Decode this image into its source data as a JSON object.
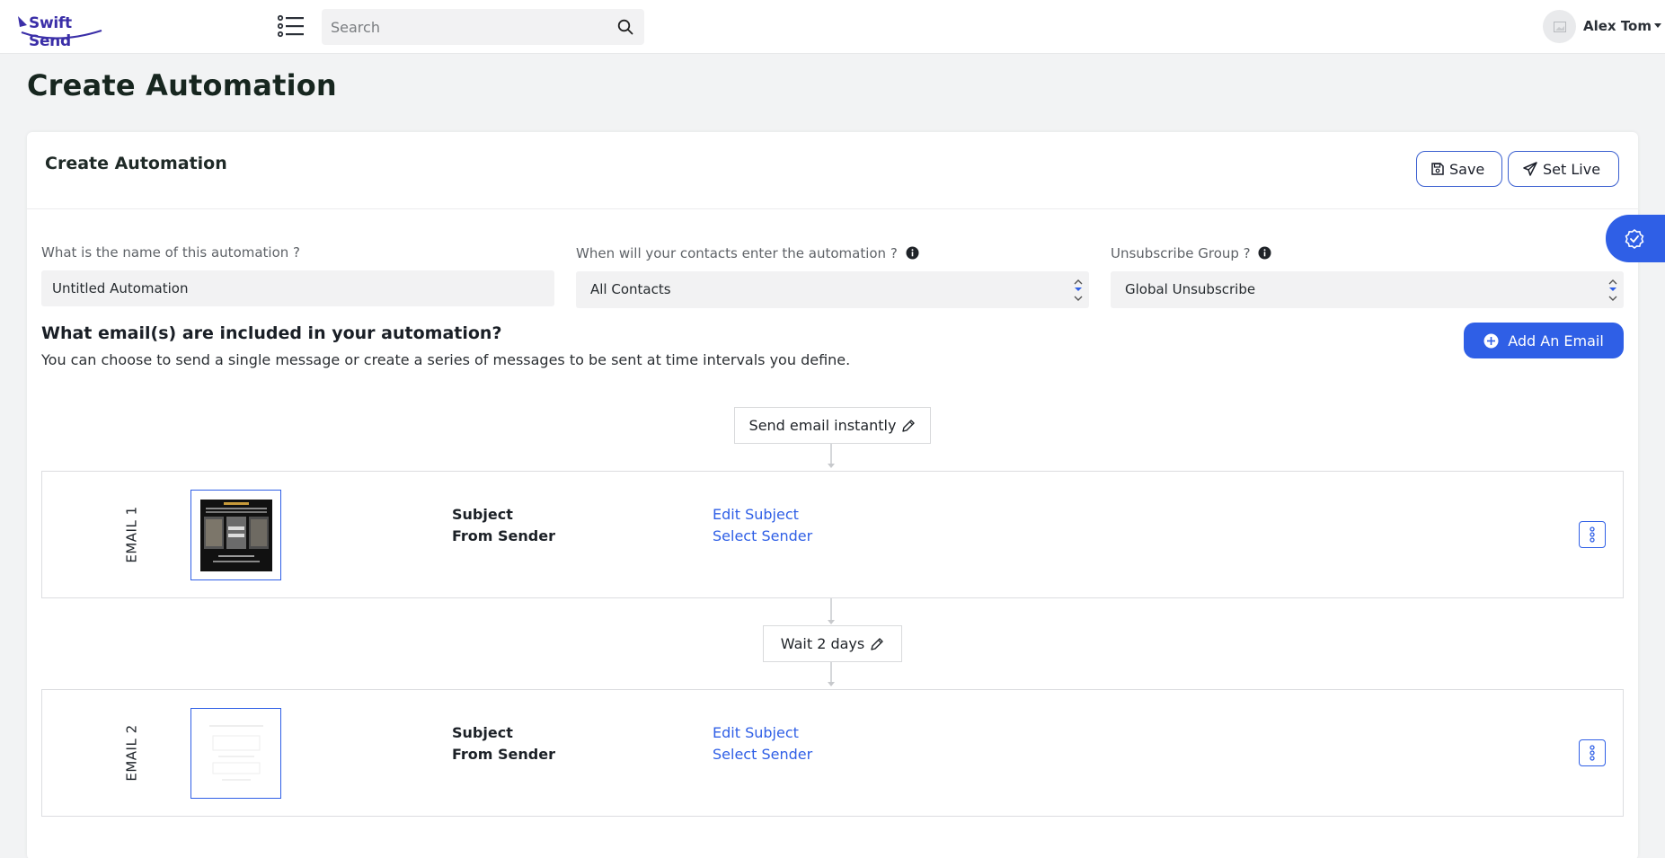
{
  "header": {
    "logo_text": "Swift Send",
    "search_placeholder": "Search",
    "user_name": "Alex Tom"
  },
  "page": {
    "title": "Create Automation"
  },
  "card": {
    "title": "Create Automation",
    "save_label": "Save",
    "set_live_label": "Set Live"
  },
  "form": {
    "name_label": "What is the name of this automation ?",
    "name_value": "Untitled Automation",
    "entry_label": "When will your contacts enter the automation ?",
    "entry_value": "All Contacts",
    "unsub_label": "Unsubscribe Group ?",
    "unsub_value": "Global Unsubscribe"
  },
  "emails_section": {
    "title": "What email(s) are included in your automation?",
    "subtitle": "You can choose to send a single message or create a series of messages to be sent at time intervals you define.",
    "add_label": "Add An Email"
  },
  "steps": {
    "trigger_label": "Send email instantly",
    "wait_label": "Wait 2 days"
  },
  "emails": [
    {
      "label": "EMAIL 1",
      "subject_key": "Subject",
      "sender_key": "From Sender",
      "subject_link": "Edit Subject",
      "sender_link": "Select Sender"
    },
    {
      "label": "EMAIL 2",
      "subject_key": "Subject",
      "sender_key": "From Sender",
      "subject_link": "Edit Subject",
      "sender_link": "Select Sender"
    }
  ],
  "colors": {
    "accent": "#2f5fe6",
    "brand": "#3b2fa8"
  }
}
